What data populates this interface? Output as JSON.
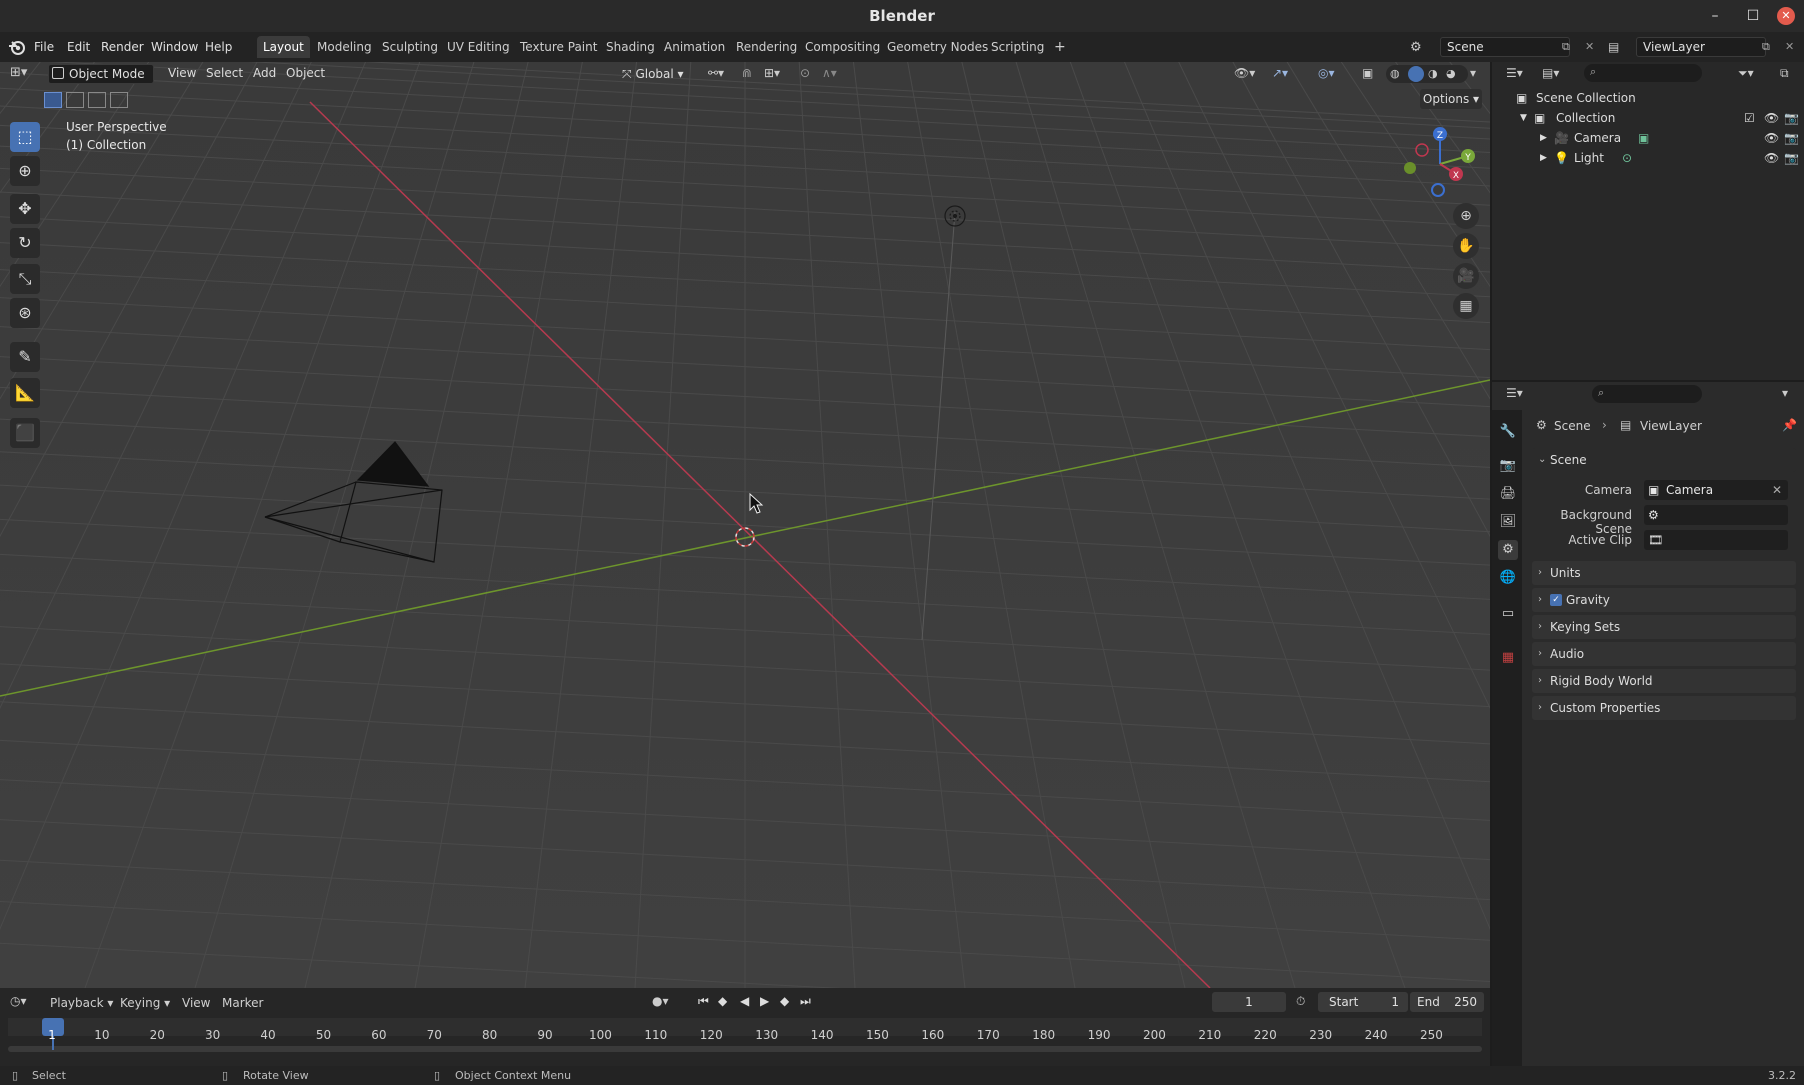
{
  "app": {
    "title": "Blender",
    "version": "3.2.2"
  },
  "menus": {
    "file": "File",
    "edit": "Edit",
    "render": "Render",
    "window": "Window",
    "help": "Help"
  },
  "workspaces": [
    "Layout",
    "Modeling",
    "Sculpting",
    "UV Editing",
    "Texture Paint",
    "Shading",
    "Animation",
    "Rendering",
    "Compositing",
    "Geometry Nodes",
    "Scripting"
  ],
  "add_workspace": "+",
  "scene_selector": {
    "value": "Scene"
  },
  "viewlayer_selector": {
    "value": "ViewLayer"
  },
  "viewport": {
    "mode": "Object Mode",
    "menus": {
      "view": "View",
      "select": "Select",
      "add": "Add",
      "object": "Object"
    },
    "orientation": "Global",
    "options": "Options",
    "perspective_label": "User Perspective",
    "collection_label": "(1) Collection"
  },
  "gizmo": {
    "z": "Z",
    "y": "Y",
    "x": "X"
  },
  "outliner": {
    "scene_collection": "Scene Collection",
    "collection": "Collection",
    "items": [
      {
        "label": "Camera"
      },
      {
        "label": "Light"
      }
    ]
  },
  "properties": {
    "breadcrumb": {
      "scene": "Scene",
      "viewlayer": "ViewLayer"
    },
    "panel_scene": "Scene",
    "fields": {
      "camera_label": "Camera",
      "camera_value": "Camera",
      "background_scene_label": "Background Scene",
      "active_clip_label": "Active Clip"
    },
    "panels": [
      "Units",
      "Gravity",
      "Keying Sets",
      "Audio",
      "Rigid Body World",
      "Custom Properties"
    ],
    "gravity_checked": true
  },
  "timeline": {
    "menus": {
      "playback": "Playback",
      "keying": "Keying",
      "view": "View",
      "marker": "Marker"
    },
    "current_frame": "1",
    "start_label": "Start",
    "start_value": "1",
    "end_label": "End",
    "end_value": "250",
    "ruler": [
      "1",
      "10",
      "20",
      "30",
      "40",
      "50",
      "60",
      "70",
      "80",
      "90",
      "100",
      "110",
      "120",
      "130",
      "140",
      "150",
      "160",
      "170",
      "180",
      "190",
      "200",
      "210",
      "220",
      "230",
      "240",
      "250"
    ]
  },
  "status": {
    "select": "Select",
    "rotate": "Rotate View",
    "context": "Object Context Menu"
  },
  "colors": {
    "accent": "#4772b3",
    "x_axis": "#c0374f",
    "y_axis": "#6f9a2a",
    "close": "#e35b4d"
  }
}
